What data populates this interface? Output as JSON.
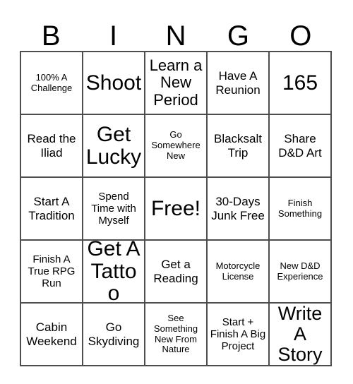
{
  "card": {
    "title": "BINGO",
    "headers": [
      "B",
      "I",
      "N",
      "G",
      "O"
    ],
    "rows": [
      [
        {
          "label": "100% A Challenge",
          "size": "xs"
        },
        {
          "label": "Shoot",
          "size": "xxl"
        },
        {
          "label": "Learn a New Period",
          "size": "lg"
        },
        {
          "label": "Have A Reunion",
          "size": "md"
        },
        {
          "label": "165",
          "size": "xxl"
        }
      ],
      [
        {
          "label": "Read the Iliad",
          "size": "md"
        },
        {
          "label": "Get Lucky",
          "size": "xxl"
        },
        {
          "label": "Go Somewhere New",
          "size": "xs"
        },
        {
          "label": "Blacksalt Trip",
          "size": "md"
        },
        {
          "label": "Share D&D Art",
          "size": "md"
        }
      ],
      [
        {
          "label": "Start A Tradition",
          "size": "md"
        },
        {
          "label": "Spend Time with Myself",
          "size": "sm"
        },
        {
          "label": "Free!",
          "size": "xxl"
        },
        {
          "label": "30-Days Junk Free",
          "size": "md"
        },
        {
          "label": "Finish Something",
          "size": "xs"
        }
      ],
      [
        {
          "label": "Finish A True RPG Run",
          "size": "sm"
        },
        {
          "label": "Get A Tattoo",
          "size": "xxl"
        },
        {
          "label": "Get a Reading",
          "size": "md"
        },
        {
          "label": "Motorcycle License",
          "size": "xs"
        },
        {
          "label": "New D&D Experience",
          "size": "xs"
        }
      ],
      [
        {
          "label": "Cabin Weekend",
          "size": "md"
        },
        {
          "label": "Go Skydiving",
          "size": "md"
        },
        {
          "label": "See Something New From Nature",
          "size": "xs"
        },
        {
          "label": "Start + Finish A Big Project",
          "size": "sm"
        },
        {
          "label": "Write A Story",
          "size": "xl"
        }
      ]
    ],
    "free_space_index": {
      "row": 2,
      "col": 2
    },
    "colors": {
      "background": "#ffffff",
      "text": "#000000",
      "border": "#4d4d4d"
    }
  }
}
